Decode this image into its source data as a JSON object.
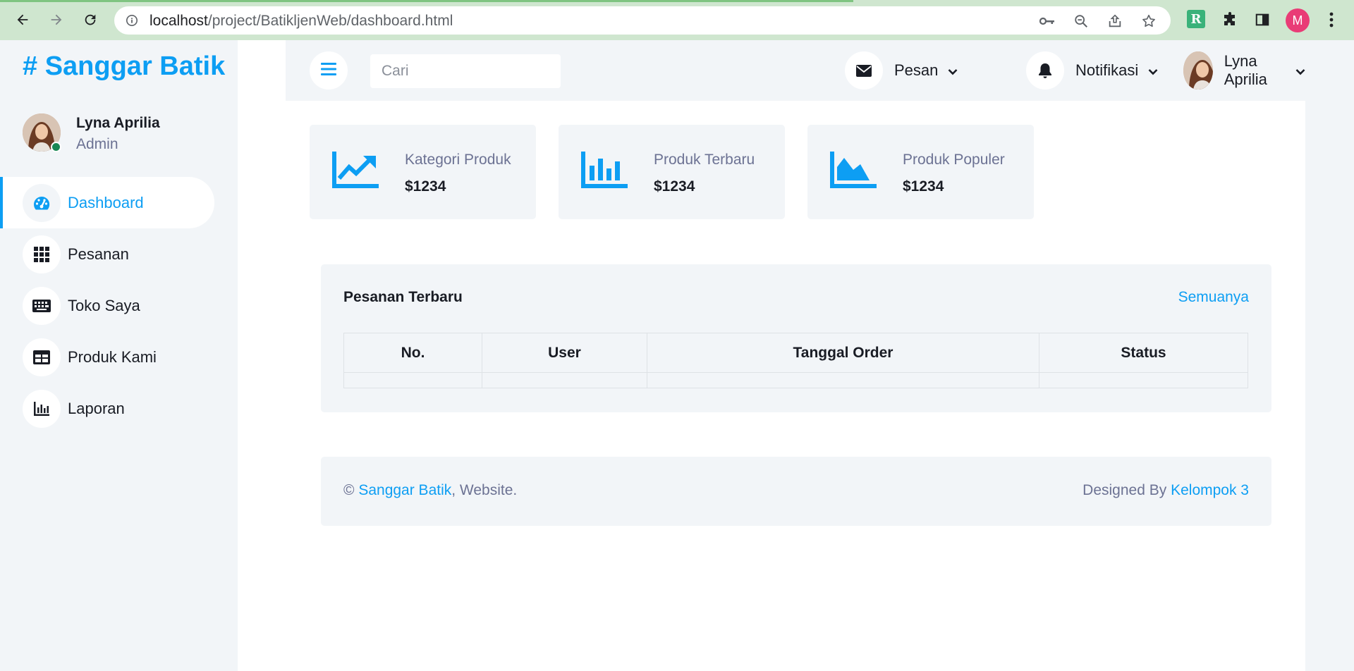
{
  "browser": {
    "url_host": "localhost",
    "url_path": "/project/BatikljenWeb/dashboard.html",
    "profile_initial": "M",
    "extension_letter": "R"
  },
  "sidebar": {
    "brand": "# Sanggar Batik",
    "profile": {
      "name": "Lyna Aprilia",
      "role": "Admin"
    },
    "items": [
      {
        "label": "Dashboard",
        "icon": "gauge-icon",
        "active": true
      },
      {
        "label": "Pesanan",
        "icon": "grid-icon"
      },
      {
        "label": "Toko Saya",
        "icon": "keyboard-icon"
      },
      {
        "label": "Produk Kami",
        "icon": "table-icon"
      },
      {
        "label": "Laporan",
        "icon": "chart-bar-icon"
      }
    ]
  },
  "topbar": {
    "search_placeholder": "Cari",
    "messages_label": "Pesan",
    "notifications_label": "Notifikasi",
    "user_name": "Lyna Aprilia"
  },
  "cards": [
    {
      "title": "Kategori Produk",
      "value": "$1234",
      "icon": "chart-line-icon"
    },
    {
      "title": "Produk Terbaru",
      "value": "$1234",
      "icon": "chart-bar-icon"
    },
    {
      "title": "Produk Populer",
      "value": "$1234",
      "icon": "chart-area-icon"
    }
  ],
  "orders": {
    "title": "Pesanan Terbaru",
    "link": "Semuanya",
    "columns": [
      "No.",
      "User",
      "Tanggal Order",
      "Status"
    ]
  },
  "footer": {
    "copyright": "©",
    "site_link": "Sanggar Batik",
    "site_suffix": ", Website.",
    "designed_by": "Designed By",
    "team_link": "Kelompok 3"
  },
  "colors": {
    "accent": "#0d9ef3",
    "background": "#f2f5f8",
    "online": "#198754"
  }
}
